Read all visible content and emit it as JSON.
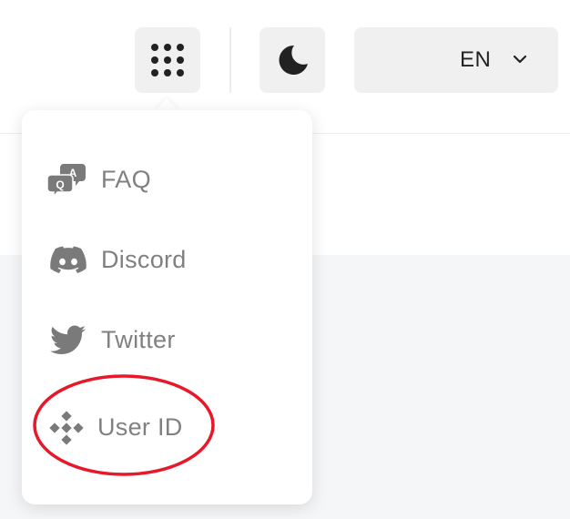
{
  "header": {
    "apps_button_icon": "grid-dots-icon",
    "theme_button_icon": "moon-icon",
    "language": {
      "selected": "EN",
      "chevron_icon": "chevron-down-icon"
    }
  },
  "dropdown": {
    "items": [
      {
        "label": "FAQ",
        "icon": "faq-qa-icon"
      },
      {
        "label": "Discord",
        "icon": "discord-icon"
      },
      {
        "label": "Twitter",
        "icon": "twitter-icon"
      },
      {
        "label": "User ID",
        "icon": "user-id-diamond-icon"
      }
    ]
  },
  "colors": {
    "icon_dark": "#222222",
    "menu_text": "#808080",
    "menu_icon": "#7a7a7a",
    "button_bg": "#f0f0f0",
    "annotation_red": "#e8182b",
    "page_bg": "#f5f6f8"
  }
}
